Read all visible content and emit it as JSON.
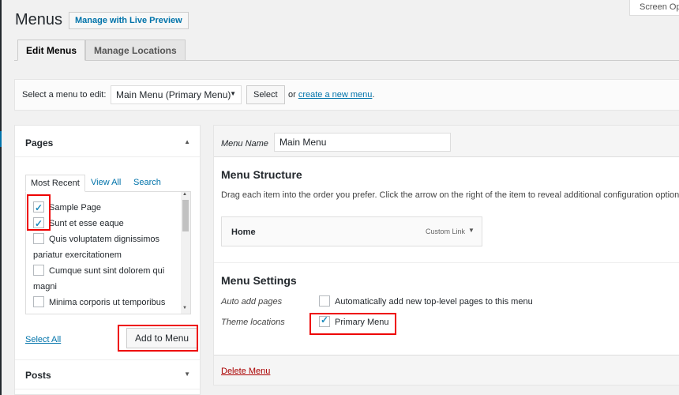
{
  "screen_options": "Screen Options",
  "title": "Menus",
  "live_preview_label": "Manage with Live Preview",
  "tabs": [
    {
      "label": "Edit Menus"
    },
    {
      "label": "Manage Locations"
    }
  ],
  "select_bar": {
    "label": "Select a menu to edit:",
    "dropdown_value": "Main Menu (Primary Menu)",
    "select_button": "Select",
    "or_text": "or",
    "create_link": "create a new menu",
    "create_suffix": "."
  },
  "pages_panel": {
    "title": "Pages",
    "tabs": [
      {
        "label": "Most Recent"
      },
      {
        "label": "View All"
      },
      {
        "label": "Search"
      }
    ],
    "items": [
      {
        "label": "Sample Page",
        "checked": true
      },
      {
        "label": "Sunt et esse eaque",
        "checked": true
      },
      {
        "label": "Quis voluptatem dignissimos pariatur exercitationem",
        "checked": false
      },
      {
        "label": "Cumque sunt sint dolorem qui magni",
        "checked": false
      },
      {
        "label": "Minima corporis ut temporibus harum itaque ipsum",
        "checked": false
      }
    ],
    "select_all": "Select All",
    "add_button": "Add to Menu"
  },
  "posts_panel": {
    "title": "Posts"
  },
  "menu_editor": {
    "name_label": "Menu Name",
    "name_value": "Main Menu",
    "structure_title": "Menu Structure",
    "structure_desc": "Drag each item into the order you prefer. Click the arrow on the right of the item to reveal additional configuration options.",
    "items": [
      {
        "title": "Home",
        "type": "Custom Link"
      }
    ],
    "settings_title": "Menu Settings",
    "auto_add_label": "Auto add pages",
    "auto_add_option": "Automatically add new top-level pages to this menu",
    "auto_add_checked": false,
    "theme_locations_label": "Theme locations",
    "primary_menu_option": "Primary Menu",
    "primary_menu_checked": true,
    "delete_link": "Delete Menu"
  },
  "colors": {
    "link": "#0073aa",
    "highlight": "#e00000",
    "delete": "#a00000"
  }
}
